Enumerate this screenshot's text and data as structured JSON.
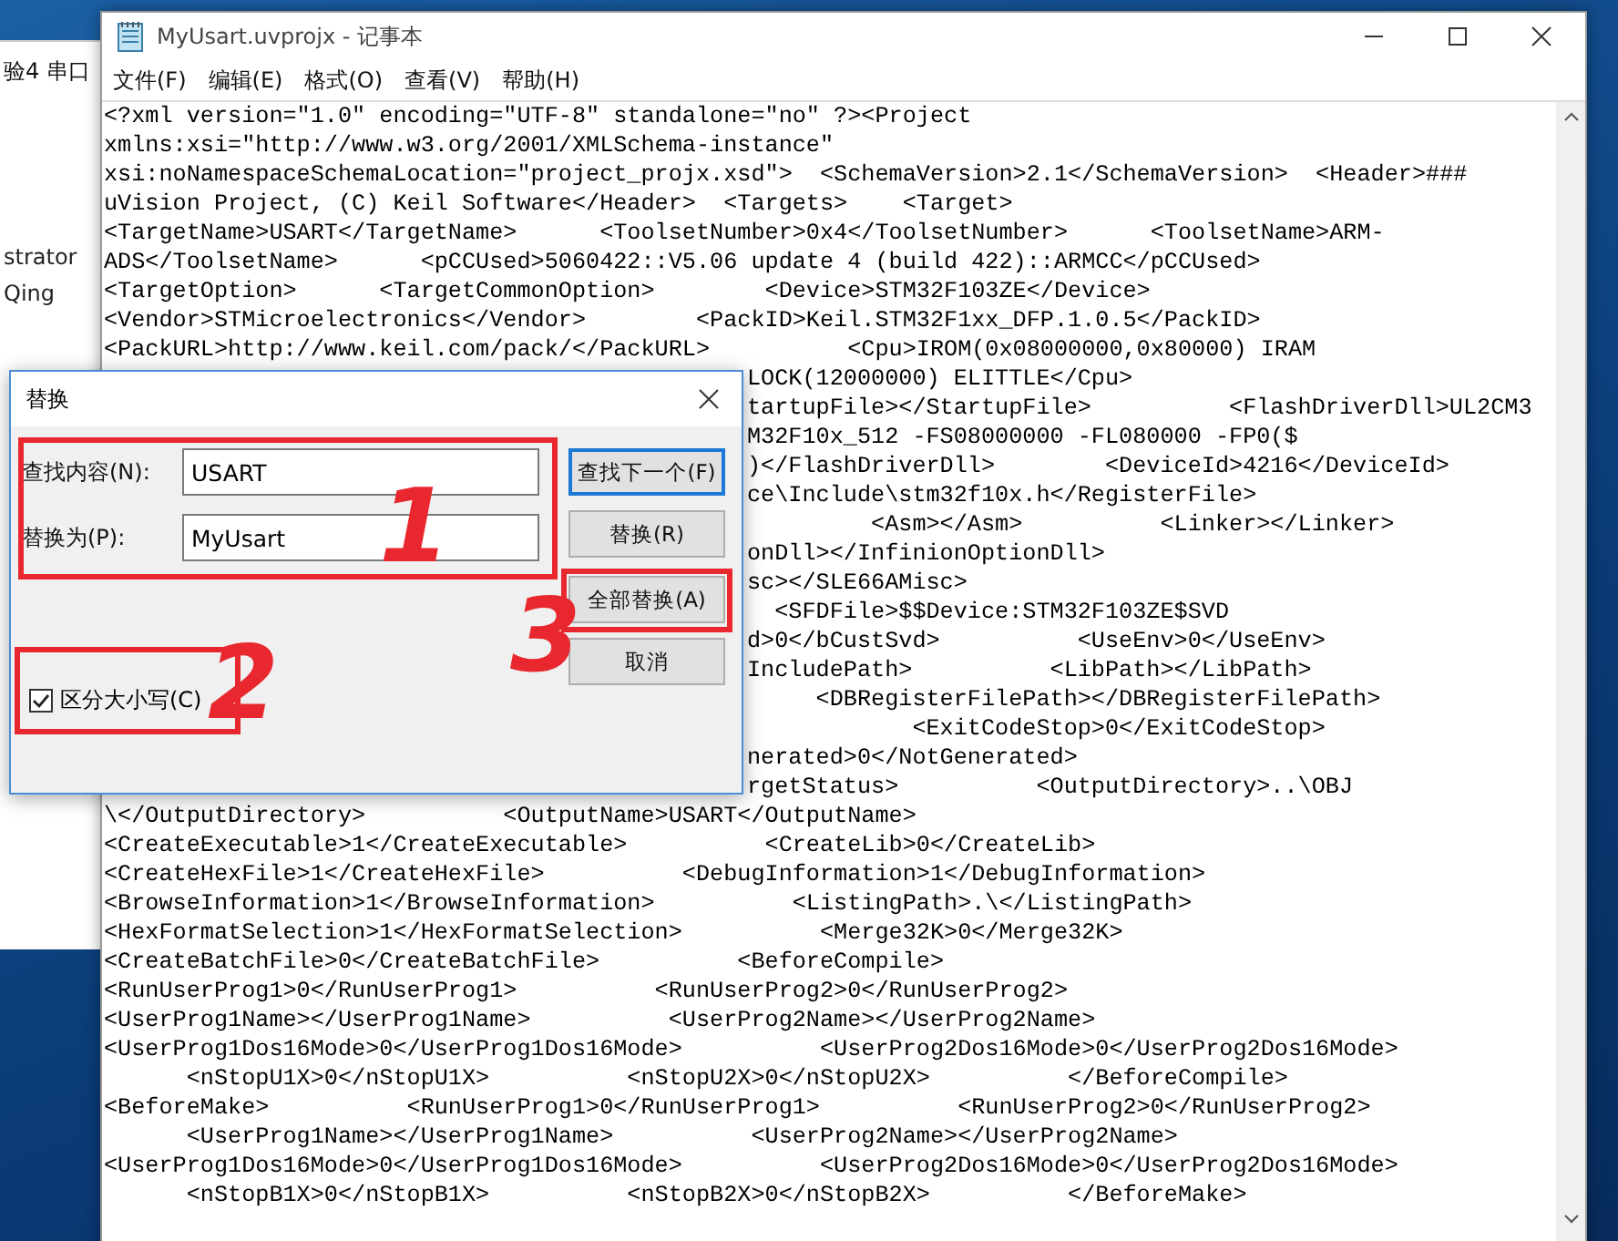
{
  "background_window": {
    "title": "验4 串口",
    "texts": [
      "strator",
      "Qing"
    ]
  },
  "window": {
    "title": "MyUsart.uvprojx - 记事本"
  },
  "menu": [
    "文件(F)",
    "编辑(E)",
    "格式(O)",
    "查看(V)",
    "帮助(H)"
  ],
  "lines": [
    {
      "text": "<?xml version=\"1.0\" encoding=\"UTF-8\" standalone=\"no\" ?><Project",
      "covered": false
    },
    {
      "text": "xmlns:xsi=\"http://www.w3.org/2001/XMLSchema-instance\"",
      "covered": false
    },
    {
      "text": "xsi:noNamespaceSchemaLocation=\"project_projx.xsd\">  <SchemaVersion>2.1</SchemaVersion>  <Header>###",
      "covered": false
    },
    {
      "text": "uVision Project, (C) Keil Software</Header>  <Targets>    <Target>",
      "covered": false
    },
    {
      "text": "<TargetName>USART</TargetName>      <ToolsetNumber>0x4</ToolsetNumber>      <ToolsetName>ARM-",
      "covered": false
    },
    {
      "text": "ADS</ToolsetName>      <pCCUsed>5060422::V5.06 update 4 (build 422)::ARMCC</pCCUsed>",
      "covered": false
    },
    {
      "text": "<TargetOption>      <TargetCommonOption>        <Device>STM32F103ZE</Device>",
      "covered": false
    },
    {
      "text": "<Vendor>STMicroelectronics</Vendor>        <PackID>Keil.STM32F1xx_DFP.1.0.5</PackID>",
      "covered": false
    },
    {
      "text": "<PackURL>http://www.keil.com/pack/</PackURL>          <Cpu>IROM(0x08000000,0x80000) IRAM",
      "covered": false
    },
    {
      "text": "LOCK(12000000) ELITTLE</Cpu>",
      "covered": true
    },
    {
      "text": "tartupFile></StartupFile>          <FlashDriverDll>UL2CM3",
      "covered": true
    },
    {
      "text": "M32F10x_512 -FS08000000 -FL080000 -FP0($",
      "covered": true
    },
    {
      "text": ")</FlashDriverDll>        <DeviceId>4216</DeviceId>",
      "covered": true
    },
    {
      "text": "ce\\Include\\stm32f10x.h</RegisterFile>",
      "covered": true
    },
    {
      "text": "         <Asm></Asm>          <Linker></Linker>",
      "covered": true
    },
    {
      "text": "onDll></InfinionOptionDll>",
      "covered": true
    },
    {
      "text": "sc></SLE66AMisc>",
      "covered": true
    },
    {
      "text": "  <SFDFile>$$Device:STM32F103ZE$SVD",
      "covered": true
    },
    {
      "text": "d>0</bCustSvd>          <UseEnv>0</UseEnv>",
      "covered": true
    },
    {
      "text": "IncludePath>          <LibPath></LibPath>",
      "covered": true
    },
    {
      "text": "     <DBRegisterFilePath></DBRegisterFilePath>",
      "covered": true
    },
    {
      "text": "            <ExitCodeStop>0</ExitCodeStop>",
      "covered": true
    },
    {
      "text": "nerated>0</NotGenerated>",
      "covered": true
    },
    {
      "text": "rgetStatus>          <OutputDirectory>..\\OBJ",
      "covered": true
    },
    {
      "text": "\\</OutputDirectory>          <OutputName>USART</OutputName>",
      "covered": false
    },
    {
      "text": "<CreateExecutable>1</CreateExecutable>          <CreateLib>0</CreateLib>",
      "covered": false
    },
    {
      "text": "<CreateHexFile>1</CreateHexFile>          <DebugInformation>1</DebugInformation>",
      "covered": false
    },
    {
      "text": "<BrowseInformation>1</BrowseInformation>          <ListingPath>.\\</ListingPath>",
      "covered": false
    },
    {
      "text": "<HexFormatSelection>1</HexFormatSelection>          <Merge32K>0</Merge32K>",
      "covered": false
    },
    {
      "text": "<CreateBatchFile>0</CreateBatchFile>          <BeforeCompile>",
      "covered": false
    },
    {
      "text": "<RunUserProg1>0</RunUserProg1>          <RunUserProg2>0</RunUserProg2>",
      "covered": false
    },
    {
      "text": "<UserProg1Name></UserProg1Name>          <UserProg2Name></UserProg2Name>",
      "covered": false
    },
    {
      "text": "<UserProg1Dos16Mode>0</UserProg1Dos16Mode>          <UserProg2Dos16Mode>0</UserProg2Dos16Mode>",
      "covered": false
    },
    {
      "text": "      <nStopU1X>0</nStopU1X>          <nStopU2X>0</nStopU2X>          </BeforeCompile>",
      "covered": false
    },
    {
      "text": "<BeforeMake>          <RunUserProg1>0</RunUserProg1>          <RunUserProg2>0</RunUserProg2>",
      "covered": false
    },
    {
      "text": "      <UserProg1Name></UserProg1Name>          <UserProg2Name></UserProg2Name>",
      "covered": false
    },
    {
      "text": "<UserProg1Dos16Mode>0</UserProg1Dos16Mode>          <UserProg2Dos16Mode>0</UserProg2Dos16Mode>",
      "covered": false
    },
    {
      "text": "      <nStopB1X>0</nStopB1X>          <nStopB2X>0</nStopB2X>          </BeforeMake>",
      "covered": false
    }
  ],
  "dialog": {
    "title": "替换",
    "fields": [
      {
        "label": "查找内容(N):",
        "value": "USART"
      },
      {
        "label": "替换为(P):",
        "value": "MyUsart"
      }
    ],
    "match_case": {
      "label": "区分大小写(C)",
      "checked": true
    },
    "buttons": [
      {
        "label": "查找下一个(F)",
        "default": true
      },
      {
        "label": "替换(R)",
        "default": false
      },
      {
        "label": "全部替换(A)",
        "default": false
      },
      {
        "label": "取消",
        "default": false
      }
    ]
  },
  "annotations": [
    "1",
    "2",
    "3"
  ]
}
